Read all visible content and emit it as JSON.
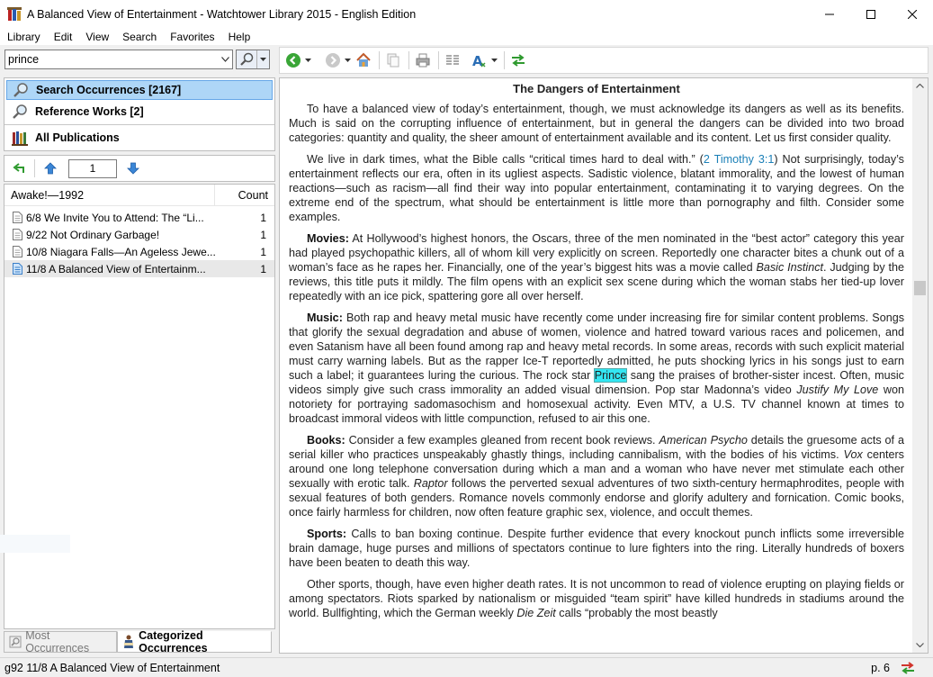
{
  "window": {
    "title": "A Balanced View of Entertainment - Watchtower Library 2015 - English Edition"
  },
  "menu": [
    "Library",
    "Edit",
    "View",
    "Search",
    "Favorites",
    "Help"
  ],
  "search": {
    "query": "prince"
  },
  "modes": {
    "search_occurrences": "Search Occurrences [2167]",
    "reference_works": "Reference Works [2]",
    "all_publications": "All Publications"
  },
  "navigator": {
    "page": "1"
  },
  "results": {
    "publication": "Awake!—1992",
    "count_header": "Count",
    "rows": [
      {
        "title": "6/8 We Invite You to Attend: The “Li...",
        "count": "1"
      },
      {
        "title": "9/22 Not Ordinary Garbage!",
        "count": "1"
      },
      {
        "title": "10/8 Niagara Falls—An Ageless Jewe...",
        "count": "1"
      },
      {
        "title": "11/8 A Balanced View of Entertainm...",
        "count": "1"
      }
    ]
  },
  "tabs": {
    "most": "Most Occurrences",
    "categorized": "Categorized Occurrences"
  },
  "article": {
    "title": "The Dangers of Entertainment",
    "p1": "To have a balanced view of today’s entertainment, though, we must acknowledge its dangers as well as its benefits. Much is said on the corrupting influence of entertainment, but in general the dangers can be divided into two broad categories: quantity and quality, the sheer amount of entertainment available and its content. Let us first consider quality.",
    "p2a": "We live in dark times, what the Bible calls “critical times hard to deal with.” (",
    "p2ref": "2 Timothy 3:1",
    "p2b": ") Not surprisingly, today’s entertainment reflects our era, often in its ugliest aspects. Sadistic violence, blatant immorality, and the lowest of human reactions—such as racism—all find their way into popular entertainment, contaminating it to varying degrees. On the extreme end of the spectrum, what should be entertainment is little more than pornography and filth. Consider some examples.",
    "p3label": "Movies:",
    "p3a": " At Hollywood’s highest honors, the Oscars, three of the men nominated in the “best actor” category this year had played psychopathic killers, all of whom kill very explicitly on screen. Reportedly one character bites a chunk out of a woman’s face as he rapes her. Financially, one of the year’s biggest hits was a movie called ",
    "p3i": "Basic Instinct",
    "p3b": ". Judging by the reviews, this title puts it mildly. The film opens with an explicit sex scene during which the woman stabs her tied-up lover repeatedly with an ice pick, spattering gore all over herself.",
    "p4label": "Music:",
    "p4a": " Both rap and heavy metal music have recently come under increasing fire for similar content problems. Songs that glorify the sexual degradation and abuse of women, violence and hatred toward various races and policemen, and even Satanism have all been found among rap and heavy metal records. In some areas, records with such explicit material must carry warning labels. But as the rapper Ice-T reportedly admitted, he puts shocking lyrics in his songs just to earn such a label; it guarantees luring the curious. The rock star ",
    "p4hl": "Prince",
    "p4b": " sang the praises of brother-sister incest. Often, music videos simply give such crass immorality an added visual dimension. Pop star Madonna’s video ",
    "p4i": "Justify My Love",
    "p4c": " won notoriety for portraying sadomasochism and homosexual activity. Even MTV, a U.S. TV channel known at times to broadcast immoral videos with little compunction, refused to air this one.",
    "p5label": "Books:",
    "p5a": " Consider a few examples gleaned from recent book reviews. ",
    "p5i1": "American Psycho",
    "p5b": " details the gruesome acts of a serial killer who practices unspeakably ghastly things, including cannibalism, with the bodies of his victims. ",
    "p5i2": "Vox",
    "p5c": " centers around one long telephone conversation during which a man and a woman who have never met stimulate each other sexually with erotic talk. ",
    "p5i3": "Raptor",
    "p5d": " follows the perverted sexual adventures of two sixth-century hermaphrodites, people with sexual features of both genders. Romance novels commonly endorse and glorify adultery and fornication. Comic books, once fairly harmless for children, now often feature graphic sex, violence, and occult themes.",
    "p6label": "Sports:",
    "p6a": " Calls to ban boxing continue. Despite further evidence that every knockout punch inflicts some irreversible brain damage, huge purses and millions of spectators continue to lure fighters into the ring. Literally hundreds of boxers have been beaten to death this way.",
    "p7a": "Other sports, though, have even higher death rates. It is not uncommon to read of violence erupting on playing fields or among spectators. Riots sparked by nationalism or misguided “team spirit” have killed hundreds in stadiums around the world. Bullfighting, which the German weekly ",
    "p7i": "Die Zeit",
    "p7b": " calls “probably the most beastly"
  },
  "status": {
    "location": "g92 11/8 A Balanced View of Entertainment",
    "page": "p. 6"
  },
  "colors": {
    "selection": "#aed6f7",
    "highlight": "#33e6f2",
    "link": "#1a7fb7"
  }
}
